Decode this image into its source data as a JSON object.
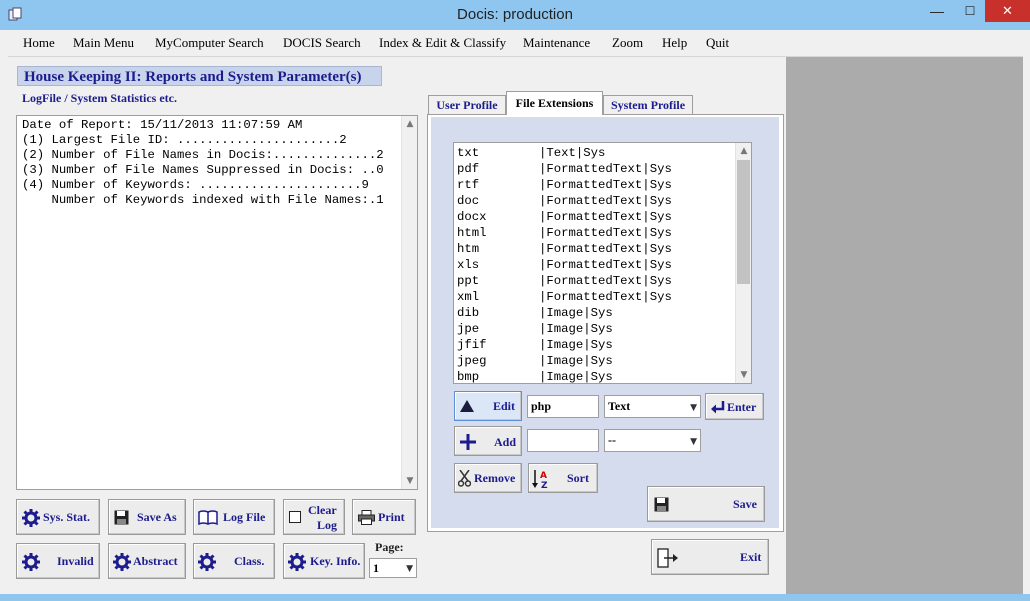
{
  "window": {
    "title": "Docis: production",
    "minimize": "—",
    "maximize": "☐",
    "close": "✕"
  },
  "menu": [
    "Home",
    "Main Menu",
    "MyComputer Search",
    "DOCIS Search",
    "Index & Edit & Classify",
    "Maintenance",
    "Zoom",
    "Help",
    "Quit"
  ],
  "page": {
    "title": "House Keeping II:  Reports and System Parameter(s)",
    "subtitle": "LogFile / System Statistics  etc."
  },
  "report": {
    "lines": [
      "Date of Report: 15/11/2013 11:07:59 AM",
      "(1) Largest File ID: ......................2",
      "(2) Number of File Names in Docis:..............2",
      "(3) Number of File Names Suppressed in Docis: ..0",
      "(4) Number of Keywords: ......................9",
      "    Number of Keywords indexed with File Names:.1"
    ]
  },
  "buttons": {
    "sys_stat": "Sys. Stat.",
    "save_as": "Save As",
    "log_file": "Log File",
    "clear_log_1": "Clear",
    "clear_log_2": "Log",
    "print": "Print",
    "invalid": "Invalid",
    "abstract": "Abstract",
    "class": "Class.",
    "key_info": "Key. Info.",
    "edit": "Edit",
    "enter": "Enter",
    "add": "Add",
    "remove": "Remove",
    "sort": "Sort",
    "save": "Save",
    "exit": "Exit"
  },
  "page_selector": {
    "label": "Page:",
    "value": "1"
  },
  "tabs": [
    {
      "label": "User Profile",
      "active": false
    },
    {
      "label": "File Extensions",
      "active": true
    },
    {
      "label": "System Profile",
      "active": false
    }
  ],
  "extensions": [
    {
      "ext": "txt",
      "category": "|Text|Sys"
    },
    {
      "ext": "pdf",
      "category": "|FormattedText|Sys"
    },
    {
      "ext": "rtf",
      "category": "|FormattedText|Sys"
    },
    {
      "ext": "doc",
      "category": "|FormattedText|Sys"
    },
    {
      "ext": "docx",
      "category": "|FormattedText|Sys"
    },
    {
      "ext": "html",
      "category": "|FormattedText|Sys"
    },
    {
      "ext": "htm",
      "category": "|FormattedText|Sys"
    },
    {
      "ext": "xls",
      "category": "|FormattedText|Sys"
    },
    {
      "ext": "ppt",
      "category": "|FormattedText|Sys"
    },
    {
      "ext": "xml",
      "category": "|FormattedText|Sys"
    },
    {
      "ext": "dib",
      "category": "|Image|Sys"
    },
    {
      "ext": "jpe",
      "category": "|Image|Sys"
    },
    {
      "ext": "jfif",
      "category": "|Image|Sys"
    },
    {
      "ext": "jpeg",
      "category": "|Image|Sys"
    },
    {
      "ext": "bmp",
      "category": "|Image|Sys"
    }
  ],
  "edit_row": {
    "extension_value": "php",
    "type_value": "Text"
  },
  "add_row": {
    "extension_value": "",
    "type_value": "--"
  },
  "icons": {
    "app": "app-icon",
    "gear": "gear-icon",
    "floppy": "floppy-icon",
    "book": "book-icon",
    "checkbox": "checkbox-icon",
    "printer": "printer-icon",
    "triangle": "triangle-up-icon",
    "plus": "plus-icon",
    "scissors": "scissors-icon",
    "sort": "sort-az-icon",
    "enter": "enter-icon",
    "exit": "exit-icon"
  },
  "colors": {
    "titlebar": "#8fc6f0",
    "close": "#c7302b",
    "accent_text": "#1c1c8c",
    "panel": "#d5dcee",
    "gray_area": "#ababab"
  }
}
